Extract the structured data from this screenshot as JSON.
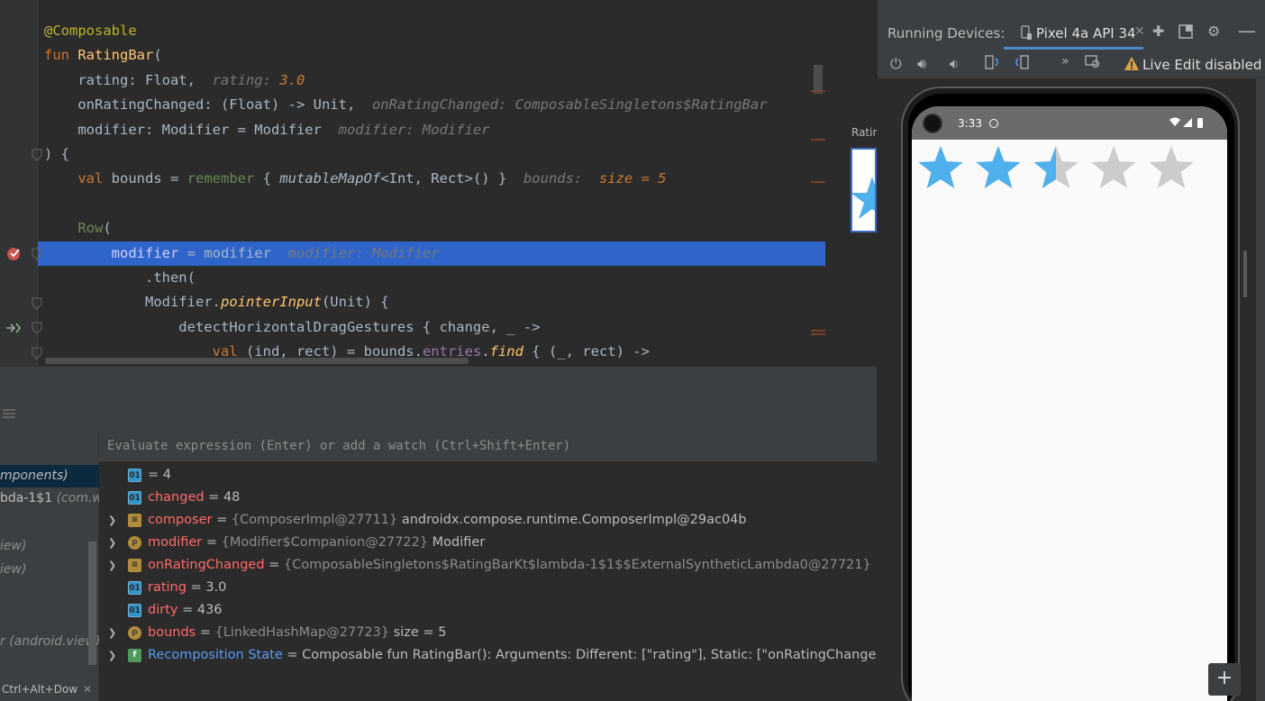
{
  "editor": {
    "lines": [
      {
        "parts": [
          {
            "t": "@Composable",
            "c": "ann"
          }
        ]
      },
      {
        "parts": [
          {
            "t": "fun ",
            "c": "kw"
          },
          {
            "t": "RatingBar",
            "c": "fn"
          },
          {
            "t": "(",
            "c": ""
          }
        ]
      },
      {
        "parts": [
          {
            "t": "    rating: Float,",
            "c": ""
          },
          {
            "t": "  rating: ",
            "c": "hint"
          },
          {
            "t": "3.0",
            "c": "hint-orange"
          }
        ]
      },
      {
        "parts": [
          {
            "t": "    onRatingChanged: (Float) -> Unit,",
            "c": ""
          },
          {
            "t": "  onRatingChanged: ComposableSingletons$RatingBar",
            "c": "hint"
          }
        ]
      },
      {
        "parts": [
          {
            "t": "    modifier: Modifier = Modifier",
            "c": ""
          },
          {
            "t": "  modifier: Modifier",
            "c": "hint"
          }
        ]
      },
      {
        "parts": [
          {
            "t": ") {",
            "c": ""
          }
        ]
      },
      {
        "parts": [
          {
            "t": "    ",
            "c": ""
          },
          {
            "t": "val",
            "c": "kw"
          },
          {
            "t": " bounds = ",
            "c": ""
          },
          {
            "t": "remember",
            "c": "compose"
          },
          {
            "t": " { ",
            "c": ""
          },
          {
            "t": "mutableMapOf",
            "c": "it"
          },
          {
            "t": "<Int, Rect>() }",
            "c": ""
          },
          {
            "t": "  bounds: ",
            "c": "hint"
          },
          {
            "t": " size = 5",
            "c": "hint-orange"
          }
        ]
      },
      {
        "parts": [
          {
            "t": "",
            "c": ""
          }
        ]
      },
      {
        "parts": [
          {
            "t": "    Row",
            "c": "compose"
          },
          {
            "t": "(",
            "c": ""
          }
        ]
      },
      {
        "parts": [
          {
            "t": "        modifier",
            "c": "hlparam"
          },
          {
            "t": " = ",
            "c": ""
          },
          {
            "t": "modifier",
            "c": ""
          },
          {
            "t": "  modifier: Modifier",
            "c": "hint"
          }
        ],
        "highlight": true
      },
      {
        "parts": [
          {
            "t": "            .then(",
            "c": ""
          }
        ]
      },
      {
        "parts": [
          {
            "t": "            Modifier.",
            "c": ""
          },
          {
            "t": "pointerInput",
            "c": "itf"
          },
          {
            "t": "(Unit) {",
            "c": ""
          }
        ]
      },
      {
        "parts": [
          {
            "t": "                detectHorizontalDragGestures { change, _ ->",
            "c": ""
          }
        ]
      },
      {
        "parts": [
          {
            "t": "                    ",
            "c": ""
          },
          {
            "t": "val",
            "c": "kw"
          },
          {
            "t": " (ind, rect) = bounds.",
            "c": ""
          },
          {
            "t": "entries",
            "c": "purple"
          },
          {
            "t": ".",
            "c": ""
          },
          {
            "t": "find",
            "c": "itf"
          },
          {
            "t": " { (_, rect) ->",
            "c": ""
          }
        ]
      }
    ]
  },
  "preview": {
    "label": "Ratin"
  },
  "debugger": {
    "eval_placeholder": "Evaluate expression (Enter) or add a watch (Ctrl+Shift+Enter)",
    "frames": [
      {
        "text": "mponents)",
        "selected": true
      },
      {
        "text": "bda-1$1",
        "italic": " (com.w"
      },
      {
        "text": "",
        "italic": ""
      },
      {
        "text": "",
        "italic": "iew)"
      },
      {
        "text": "",
        "italic": "iew)"
      },
      {
        "text": "",
        "italic": ""
      },
      {
        "text": "",
        "italic": ""
      },
      {
        "text": "",
        "italic": "r (android.view)"
      }
    ],
    "shortcut_hint": "Ctrl+Alt+Dow",
    "variables": [
      {
        "icon": "prim",
        "icon_text": "01",
        "expandable": false,
        "name": "",
        "eq": " = ",
        "value": "4",
        "type": ""
      },
      {
        "icon": "prim",
        "icon_text": "01",
        "expandable": false,
        "name": "changed",
        "eq": " = ",
        "value": "48",
        "type": ""
      },
      {
        "icon": "field",
        "icon_text": "≡",
        "expandable": true,
        "name": "composer",
        "eq": " = ",
        "type": "{ComposerImpl@27711} ",
        "value": "androidx.compose.runtime.ComposerImpl@29ac04b"
      },
      {
        "icon": "param",
        "icon_text": "p",
        "expandable": true,
        "name": "modifier",
        "eq": " = ",
        "type": "{Modifier$Companion@27722} ",
        "value": "Modifier"
      },
      {
        "icon": "field",
        "icon_text": "≡",
        "expandable": true,
        "name": "onRatingChanged",
        "eq": " = ",
        "type": "{ComposableSingletons$RatingBarKt$lambda-1$1$$ExternalSyntheticLambda0@27721}",
        "value": ""
      },
      {
        "icon": "prim",
        "icon_text": "01",
        "expandable": false,
        "name": "rating",
        "eq": " = ",
        "value": "3.0",
        "type": ""
      },
      {
        "icon": "prim",
        "icon_text": "01",
        "expandable": false,
        "name": "dirty",
        "eq": " = ",
        "value": "436",
        "type": ""
      },
      {
        "icon": "param",
        "icon_text": "p",
        "expandable": true,
        "name": "bounds",
        "eq": " = ",
        "type": "{LinkedHashMap@27723} ",
        "value": " size = 5"
      },
      {
        "icon": "f",
        "icon_text": "f",
        "expandable": true,
        "name": "Recomposition State",
        "name_style": "blue",
        "eq": " = ",
        "type": "",
        "value": "Composable fun RatingBar(): Arguments: Different: [\"rating\"], Static: [\"onRatingChanged\", \"mod"
      }
    ]
  },
  "devices": {
    "title": "Running Devices:",
    "tab_label": "Pixel 4a API 34",
    "live_edit": "Live Edit disabled",
    "phone": {
      "time": "3:33",
      "rating": 2.5,
      "max_stars": 5,
      "star_filled_color": "#4fb0ee",
      "star_empty_color": "#cccccc"
    }
  },
  "colors": {
    "highlight": "#2f65ca",
    "editor_bg": "#2b2b2b",
    "panel_bg": "#3c3f41"
  }
}
